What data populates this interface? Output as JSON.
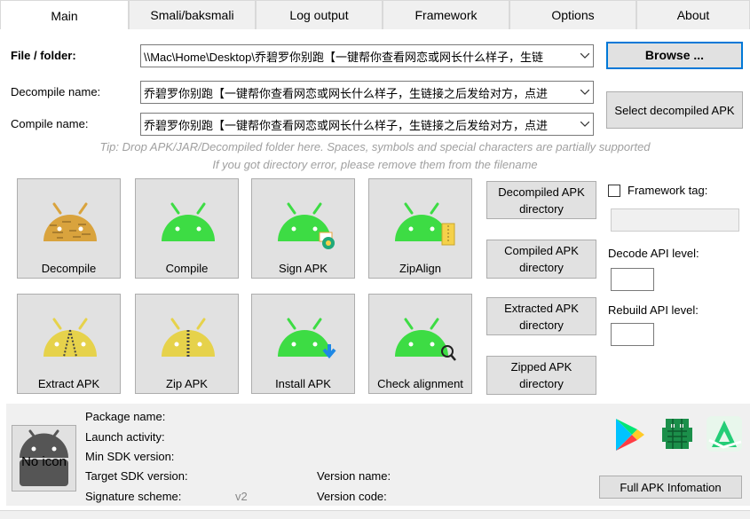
{
  "tabs": [
    "Main",
    "Smali/baksmali",
    "Log output",
    "Framework",
    "Options",
    "About"
  ],
  "form": {
    "file_label": "File / folder:",
    "file_value": "\\\\Mac\\Home\\Desktop\\乔碧罗你别跑【一键帮你查看网恋或网长什么样子，生链",
    "decompile_label": "Decompile name:",
    "decompile_value": "乔碧罗你别跑【一键帮你查看网恋或网长什么样子，生链接之后发给对方，点进",
    "compile_label": "Compile name:",
    "compile_value": "乔碧罗你别跑【一键帮你查看网恋或网长什么样子，生链接之后发给对方，点进"
  },
  "buttons": {
    "browse": "Browse ...",
    "select_decompiled": "Select decompiled APK",
    "decompiled_dir": "Decompiled APK directory",
    "compiled_dir": "Compiled APK directory",
    "extracted_dir": "Extracted APK directory",
    "zipped_dir": "Zipped APK directory",
    "full_info": "Full APK Infomation"
  },
  "tips": {
    "line1": "Tip: Drop APK/JAR/Decompiled folder here. Spaces, symbols and special characters are partially supported",
    "line2": "If you got directory error, please remove them from the filename"
  },
  "tiles": {
    "decompile": "Decompile",
    "compile": "Compile",
    "sign": "Sign APK",
    "zipalign": "ZipAlign",
    "extract": "Extract APK",
    "zip": "Zip APK",
    "install": "Install APK",
    "check": "Check alignment"
  },
  "options": {
    "framework_tag": "Framework tag:",
    "decode_api": "Decode API level:",
    "rebuild_api": "Rebuild API level:"
  },
  "apkinfo": {
    "no_icon": "No icon",
    "package_name": "Package name:",
    "launch_activity": "Launch activity:",
    "min_sdk": "Min SDK version:",
    "target_sdk": "Target SDK version:",
    "signature": "Signature scheme:",
    "signature_value": "v2",
    "version_name": "Version name:",
    "version_code": "Version code:"
  },
  "colors": {
    "android_green": "#3ddc44",
    "android_yellow": "#e6d24b",
    "android_brown": "#d9a33d",
    "accent_blue": "#0078d7"
  }
}
